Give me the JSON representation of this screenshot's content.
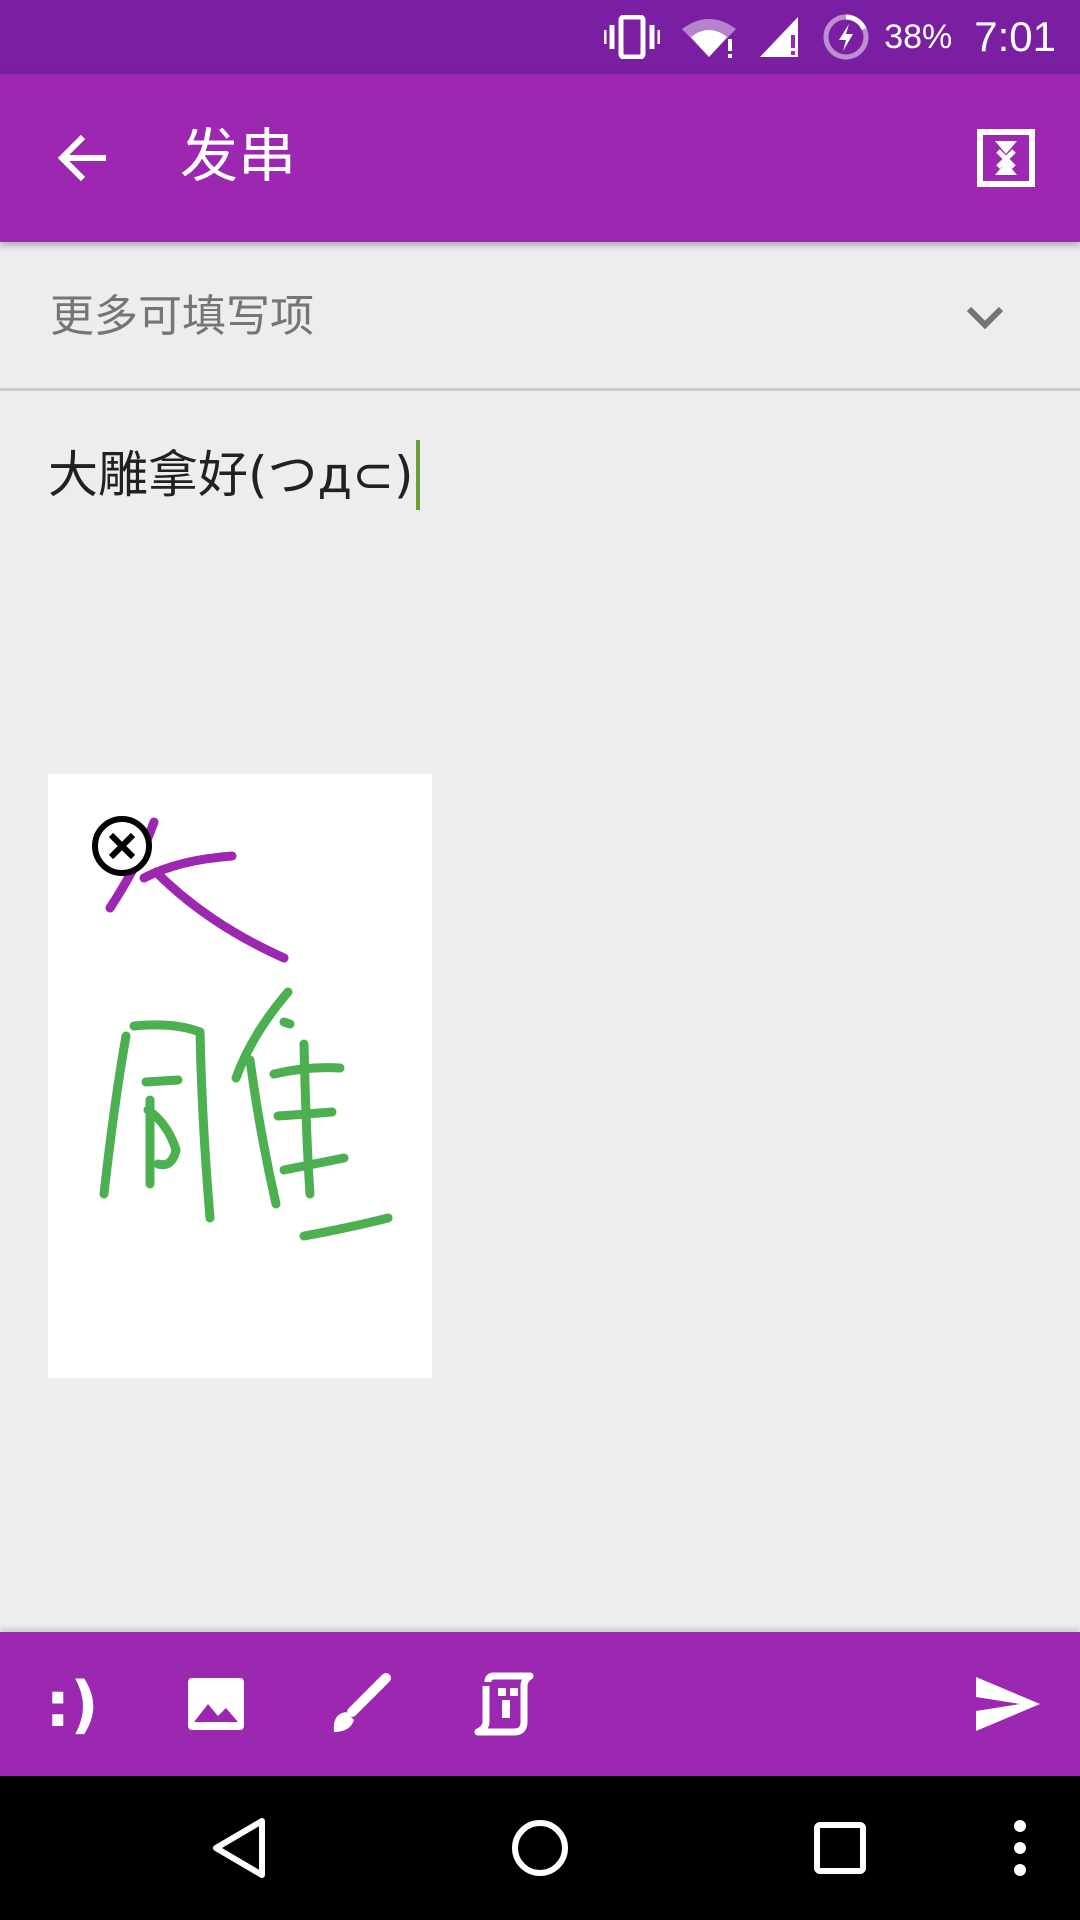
{
  "status_bar": {
    "battery_percent": "38%",
    "time": "7:01",
    "icons": [
      "vibrate-icon",
      "wifi-icon",
      "cell-signal-icon",
      "battery-charging-icon"
    ]
  },
  "app_bar": {
    "title": "发串",
    "back_icon": "arrow-back-icon",
    "clear_icon": "clear-draft-icon"
  },
  "more_fields": {
    "label": "更多可填写项",
    "icon": "chevron-down-icon"
  },
  "message": {
    "text": "大雕拿好(つд⊂)"
  },
  "attachment": {
    "type": "drawing",
    "remove_icon": "close-circle-icon",
    "stroke_colors": [
      "#9c27b0",
      "#4caf50"
    ]
  },
  "toolbar": {
    "emoticon_label": ":)",
    "icons": [
      "image-icon",
      "brush-icon",
      "doodle-icon",
      "send-icon"
    ]
  },
  "colors": {
    "status_bar": "#7b1fa2",
    "primary": "#9c27b0",
    "background": "#ededed",
    "caret": "#689f38"
  }
}
